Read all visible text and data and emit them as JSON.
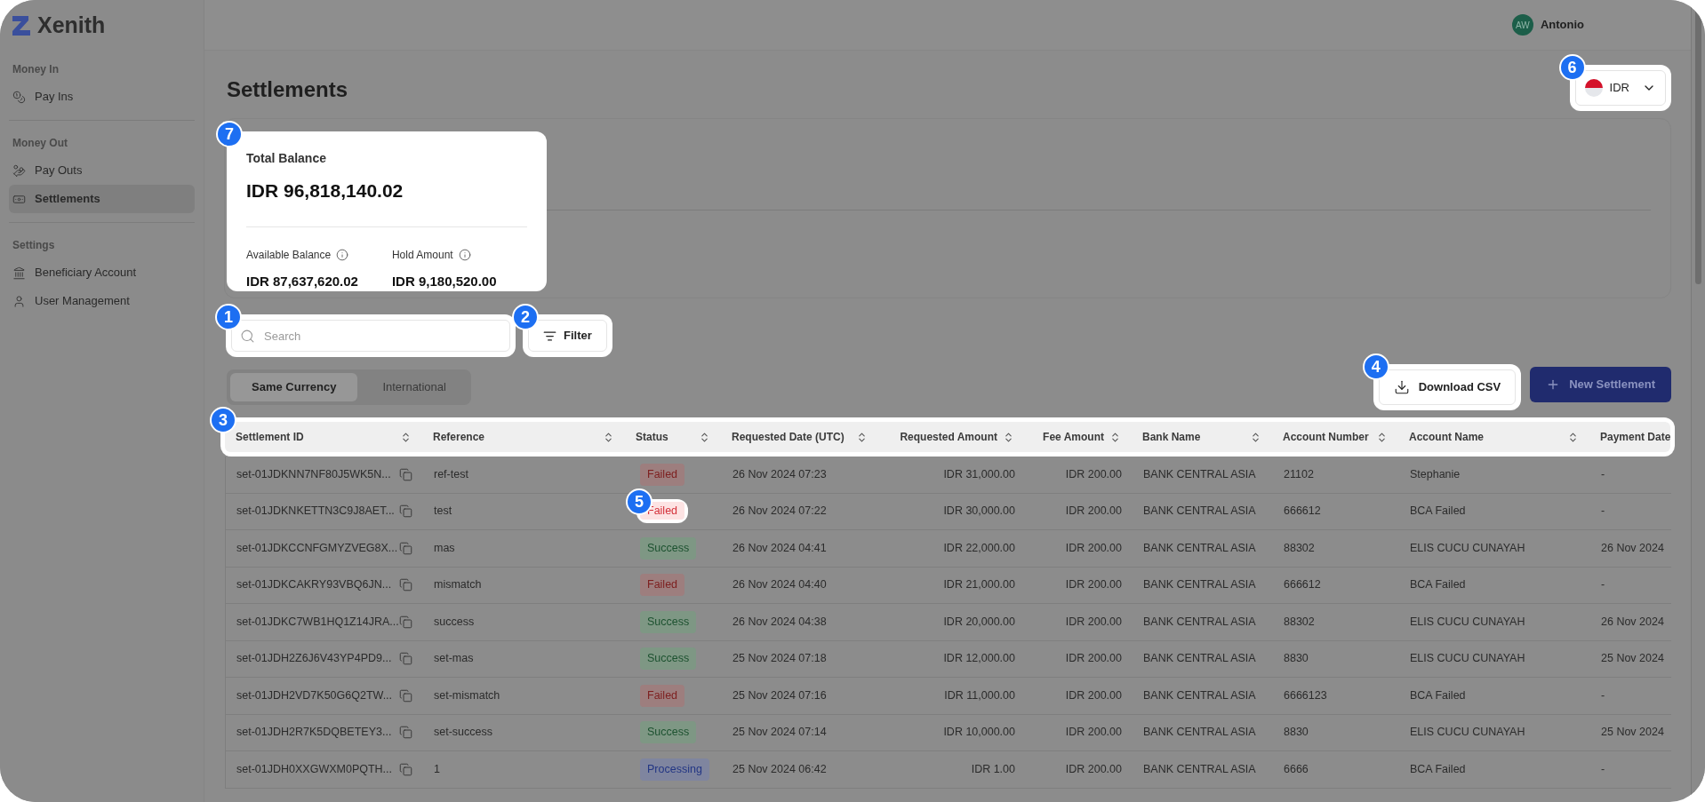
{
  "app": {
    "logo": "Xenith"
  },
  "user": {
    "initials": "AW",
    "name": "Antonio"
  },
  "sidebar": {
    "sections": [
      {
        "title": "Money In",
        "items": [
          {
            "label": "Pay Ins",
            "selected": false
          }
        ]
      },
      {
        "title": "Money Out",
        "items": [
          {
            "label": "Pay Outs",
            "selected": false
          },
          {
            "label": "Settlements",
            "selected": true
          }
        ]
      },
      {
        "title": "Settings",
        "items": [
          {
            "label": "Beneficiary Account",
            "selected": false
          },
          {
            "label": "User Management",
            "selected": false
          }
        ]
      }
    ]
  },
  "page": {
    "title": "Settlements"
  },
  "currency": {
    "code": "IDR",
    "callout": "6"
  },
  "balance": {
    "callout": "7",
    "label": "Total Balance",
    "total": "IDR 96,818,140.02",
    "available_label": "Available Balance",
    "available": "IDR 87,637,620.02",
    "hold_label": "Hold Amount",
    "hold": "IDR 9,180,520.00"
  },
  "search": {
    "placeholder": "Search",
    "callout": "1"
  },
  "filter": {
    "label": "Filter",
    "callout": "2"
  },
  "tabs": [
    {
      "label": "Same Currency",
      "selected": true
    },
    {
      "label": "International",
      "selected": false
    }
  ],
  "download": {
    "label": "Download CSV",
    "callout": "4"
  },
  "new_button": {
    "label": "New Settlement"
  },
  "table": {
    "callout": "3",
    "columns": [
      {
        "label": "Settlement ID",
        "sortable": true
      },
      {
        "label": "Reference",
        "sortable": true
      },
      {
        "label": "Status",
        "sortable": true
      },
      {
        "label": "Requested Date (UTC)",
        "sortable": true
      },
      {
        "label": "Requested Amount",
        "sortable": true
      },
      {
        "label": "Fee Amount",
        "sortable": true
      },
      {
        "label": "Bank Name",
        "sortable": true
      },
      {
        "label": "Account Number",
        "sortable": true
      },
      {
        "label": "Account Name",
        "sortable": true
      },
      {
        "label": "Payment Date"
      }
    ],
    "rows": [
      {
        "id": "set-01JDKNN7NF80J5WK5N...",
        "reference": "ref-test",
        "status": {
          "label": "Failed",
          "kind": "failed"
        },
        "date": "26 Nov 2024 07:23",
        "amount": "IDR 31,000.00",
        "fee": "IDR 200.00",
        "bank": "BANK CENTRAL ASIA",
        "account_number": "21102",
        "account_name": "Stephanie",
        "payment_date": "-"
      },
      {
        "id": "set-01JDKNKETTN3C9J8AET...",
        "reference": "test",
        "status": {
          "label": "Failed",
          "kind": "failed",
          "callout": "5"
        },
        "date": "26 Nov 2024 07:22",
        "amount": "IDR 30,000.00",
        "fee": "IDR 200.00",
        "bank": "BANK CENTRAL ASIA",
        "account_number": "666612",
        "account_name": "BCA Failed",
        "payment_date": "-"
      },
      {
        "id": "set-01JDKCCNFGMYZVEG8X...",
        "reference": "mas",
        "status": {
          "label": "Success",
          "kind": "success"
        },
        "date": "26 Nov 2024 04:41",
        "amount": "IDR 22,000.00",
        "fee": "IDR 200.00",
        "bank": "BANK CENTRAL ASIA",
        "account_number": "88302",
        "account_name": "ELIS CUCU CUNAYAH",
        "payment_date": "26 Nov 2024"
      },
      {
        "id": "set-01JDKCAKRY93VBQ6JN...",
        "reference": "mismatch",
        "status": {
          "label": "Failed",
          "kind": "failed"
        },
        "date": "26 Nov 2024 04:40",
        "amount": "IDR 21,000.00",
        "fee": "IDR 200.00",
        "bank": "BANK CENTRAL ASIA",
        "account_number": "666612",
        "account_name": "BCA Failed",
        "payment_date": "-"
      },
      {
        "id": "set-01JDKC7WB1HQ1Z14JRA...",
        "reference": "success",
        "status": {
          "label": "Success",
          "kind": "success"
        },
        "date": "26 Nov 2024 04:38",
        "amount": "IDR 20,000.00",
        "fee": "IDR 200.00",
        "bank": "BANK CENTRAL ASIA",
        "account_number": "88302",
        "account_name": "ELIS CUCU CUNAYAH",
        "payment_date": "26 Nov 2024"
      },
      {
        "id": "set-01JDH2Z6J6V43YP4PD9...",
        "reference": "set-mas",
        "status": {
          "label": "Success",
          "kind": "success"
        },
        "date": "25 Nov 2024 07:18",
        "amount": "IDR 12,000.00",
        "fee": "IDR 200.00",
        "bank": "BANK CENTRAL ASIA",
        "account_number": "8830",
        "account_name": "ELIS CUCU CUNAYAH",
        "payment_date": "25 Nov 2024"
      },
      {
        "id": "set-01JDH2VD7K50G6Q2TW...",
        "reference": "set-mismatch",
        "status": {
          "label": "Failed",
          "kind": "failed"
        },
        "date": "25 Nov 2024 07:16",
        "amount": "IDR 11,000.00",
        "fee": "IDR 200.00",
        "bank": "BANK CENTRAL ASIA",
        "account_number": "6666123",
        "account_name": "BCA Failed",
        "payment_date": "-"
      },
      {
        "id": "set-01JDH2R7K5DQBETEY3...",
        "reference": "set-success",
        "status": {
          "label": "Success",
          "kind": "success"
        },
        "date": "25 Nov 2024 07:14",
        "amount": "IDR 10,000.00",
        "fee": "IDR 200.00",
        "bank": "BANK CENTRAL ASIA",
        "account_number": "8830",
        "account_name": "ELIS CUCU CUNAYAH",
        "payment_date": "25 Nov 2024"
      },
      {
        "id": "set-01JDH0XXGWXM0PQTH...",
        "reference": "1",
        "status": {
          "label": "Processing",
          "kind": "processing"
        },
        "date": "25 Nov 2024 06:42",
        "amount": "IDR 1.00",
        "fee": "IDR 200.00",
        "bank": "BANK CENTRAL ASIA",
        "account_number": "6666",
        "account_name": "BCA Failed",
        "payment_date": "-"
      }
    ]
  }
}
